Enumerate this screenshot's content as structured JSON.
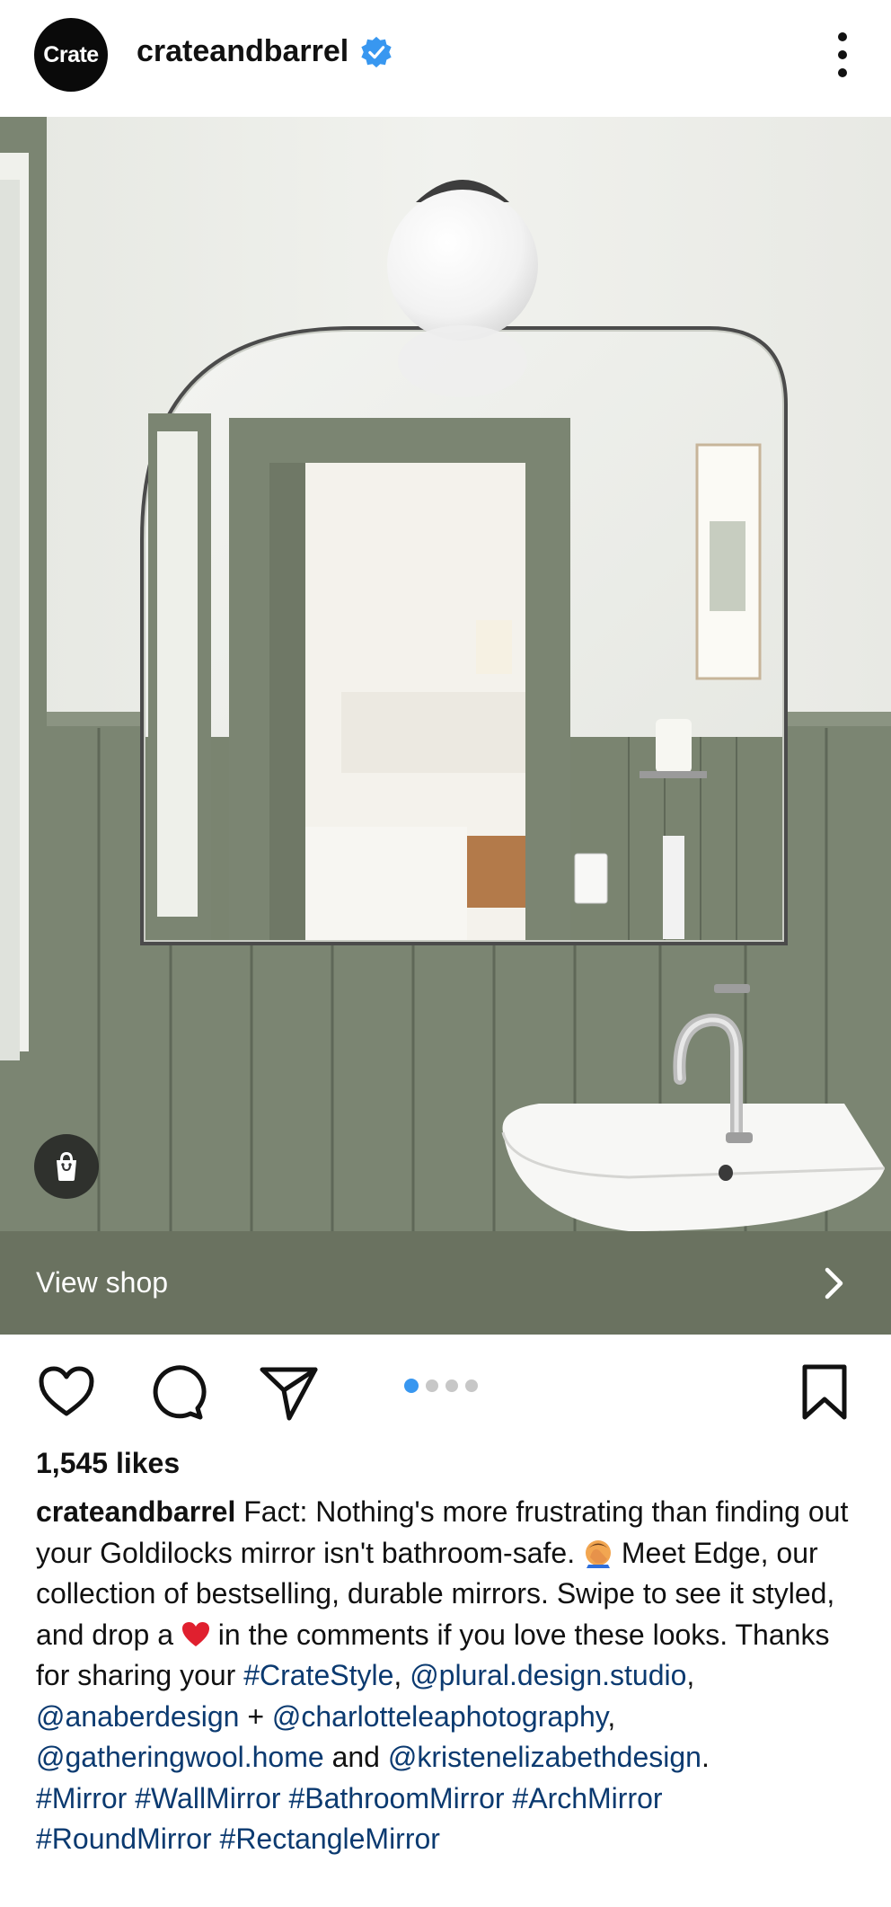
{
  "header": {
    "avatar_text": "Crate",
    "username": "crateandbarrel",
    "verified_icon": "verified-badge-icon",
    "more_icon": "more-vertical-icon"
  },
  "post": {
    "shop_icon": "shopping-bag-icon",
    "view_shop_label": "View shop",
    "view_shop_icon": "chevron-right-icon",
    "likes": "1,545 likes",
    "carousel": {
      "total": 4,
      "active": 1
    },
    "actions": [
      "heart-icon",
      "comment-icon",
      "share-icon",
      "bookmark-icon"
    ]
  },
  "caption": {
    "username": "crateandbarrel",
    "t1": " Fact: Nothing's more frustrating than finding out your Goldilocks mirror isn't bathroom-safe. ",
    "t2": " Meet Edge, our collection of bestselling, durable mirrors. Swipe to see it styled, and drop a ",
    "t3": " in the comments if you love these looks. Thanks for sharing your ",
    "tag_cratestyle": "#CrateStyle",
    "comma1": ",",
    "mention1": "@plural.design.studio",
    "comma2": ", ",
    "mention2": "@anaberdesign",
    "plus": " + ",
    "mention3": "@charlotteleaphotography",
    "comma3": ", ",
    "mention4": "@gatheringwool.home",
    "and": " and ",
    "mention5": "@kristenelizabethdesign",
    "period": ".",
    "tags": [
      "#Mirror",
      "#WallMirror",
      "#BathroomMirror",
      "#ArchMirror",
      "#RoundMirror",
      "#RectangleMirror"
    ]
  },
  "colors": {
    "link": "#0b3a70",
    "accent_dot": "#3897f0",
    "verified": "#3897f0",
    "shop_bar": "#6a7260",
    "wall_green": "#7b8572"
  }
}
